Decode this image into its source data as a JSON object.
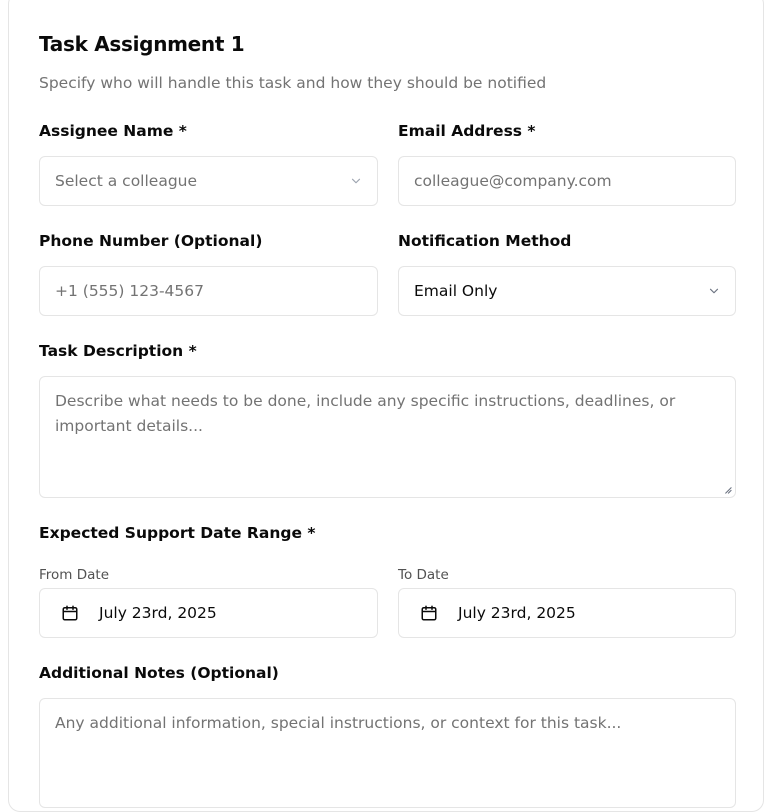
{
  "card": {
    "title": "Task Assignment 1",
    "subtitle": "Specify who will handle this task and how they should be notified"
  },
  "assignee": {
    "label": "Assignee Name *",
    "placeholder": "Select a colleague",
    "icon": "chevron-down-icon"
  },
  "email": {
    "label": "Email Address *",
    "placeholder": "colleague@company.com"
  },
  "phone": {
    "label": "Phone Number (Optional)",
    "placeholder": "+1 (555) 123-4567"
  },
  "notification": {
    "label": "Notification Method",
    "value": "Email Only",
    "icon": "chevron-down-icon"
  },
  "description": {
    "label": "Task Description *",
    "placeholder": "Describe what needs to be done, include any specific instructions, deadlines, or important details..."
  },
  "date_range": {
    "label": "Expected Support Date Range *",
    "from_label": "From Date",
    "from_value": "July 23rd, 2025",
    "to_label": "To Date",
    "to_value": "July 23rd, 2025",
    "icon": "calendar-icon"
  },
  "notes": {
    "label": "Additional Notes (Optional)",
    "placeholder": "Any additional information, special instructions, or context for this task..."
  }
}
